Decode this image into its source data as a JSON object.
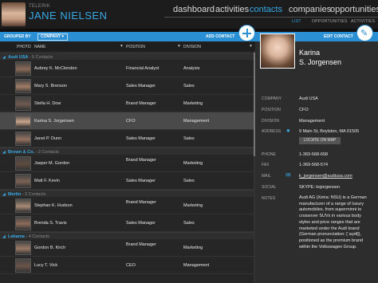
{
  "header": {
    "brand": "TELERIK",
    "user_name": "JANE NIELSEN",
    "nav": [
      "dashboard",
      "activities",
      "contacts",
      "companies",
      "opportunities"
    ],
    "nav_active": "contacts",
    "subnav": [
      "LIST",
      "OPPORTUNITIES",
      "ACTIVITIES"
    ],
    "subnav_active": "LIST"
  },
  "toolbar": {
    "group_by_label": "GROUPED BY",
    "group_by_value": "COMPANY",
    "add_contact_label": "ADD CONTACT",
    "edit_contact_label": "EDIT CONTACT"
  },
  "grid": {
    "columns": [
      "PHOTO",
      "NAME",
      "POSITION",
      "DIVISION"
    ],
    "groups": [
      {
        "name": "Audi USA",
        "count": "- 5 Contacts",
        "rows": [
          {
            "name": "Aubrey K. McClendon",
            "position": "Financial Analyst",
            "division": "Analysis"
          },
          {
            "name": "Mary S. Brenson",
            "position": "Sales Manager",
            "division": "Sales"
          },
          {
            "name": "Stella H. Dow",
            "position": "Brand Manager",
            "division": "Marketing"
          },
          {
            "name": "Karina S. Jorgensen",
            "position": "CFO",
            "division": "Management"
          },
          {
            "name": "Janet P. Dunn",
            "position": "Sales Manager",
            "division": "Sales"
          }
        ]
      },
      {
        "name": "Brown & Co.",
        "count": "- 2 Contacts",
        "rows": [
          {
            "name": "Jasper M. Gordon",
            "position": "Brand Manager",
            "division": "Marketing"
          },
          {
            "name": "Matt F. Kevin",
            "position": "Sales Manager",
            "division": "Sales"
          }
        ]
      },
      {
        "name": "Merlin",
        "count": "- 2 Contacts",
        "rows": [
          {
            "name": "Stephan K. Hudson",
            "position": "Brand Manager",
            "division": "Marketing"
          },
          {
            "name": "Brenda S. Travis",
            "position": "Sales Manager",
            "division": "Sales"
          }
        ]
      },
      {
        "name": "Lahama",
        "count": "- 4 Contacts",
        "rows": [
          {
            "name": "Gordon B. Kirch",
            "position": "Brand Manager",
            "division": "Marketing"
          },
          {
            "name": "Lucy T. Vick",
            "position": "CEO",
            "division": "Management"
          }
        ]
      }
    ]
  },
  "detail": {
    "first_name": "Karina",
    "last_name": "S. Jorgensen",
    "fields": {
      "company_label": "COMPANY",
      "company": "Audi USA",
      "position_label": "POSITION",
      "position": "CFO",
      "division_label": "DIVISION",
      "division": "Management",
      "address_label": "ADDRESS",
      "address": "9 Main St, Boylston, MA 01505",
      "locate_label": "LOCATE ON MAP",
      "phone_label": "PHONE",
      "phone": "1-369-568-658",
      "fax_label": "FAX",
      "fax": "1-369-568-574",
      "mail_label": "MAIL",
      "mail": "k_jorgensen@audiusa.com",
      "social_label": "SOCIAL",
      "social": "SKYPE: ksjorgensen",
      "notes_label": "NOTES",
      "notes": "Audi AG (Xetra: NSU) is a German manufacturer of a range of luxury automobiles, from superminni to crossover SUVs in various body styles and price ranges that are marketed under the Audi brand (German pronunciation: [ˈaʊ̯di]), positioned as the premium brand within the Volkswagen Group."
    }
  },
  "colors": {
    "accent": "#37a8e6",
    "toolbar": "#2b8fd4",
    "background": "#262626"
  }
}
